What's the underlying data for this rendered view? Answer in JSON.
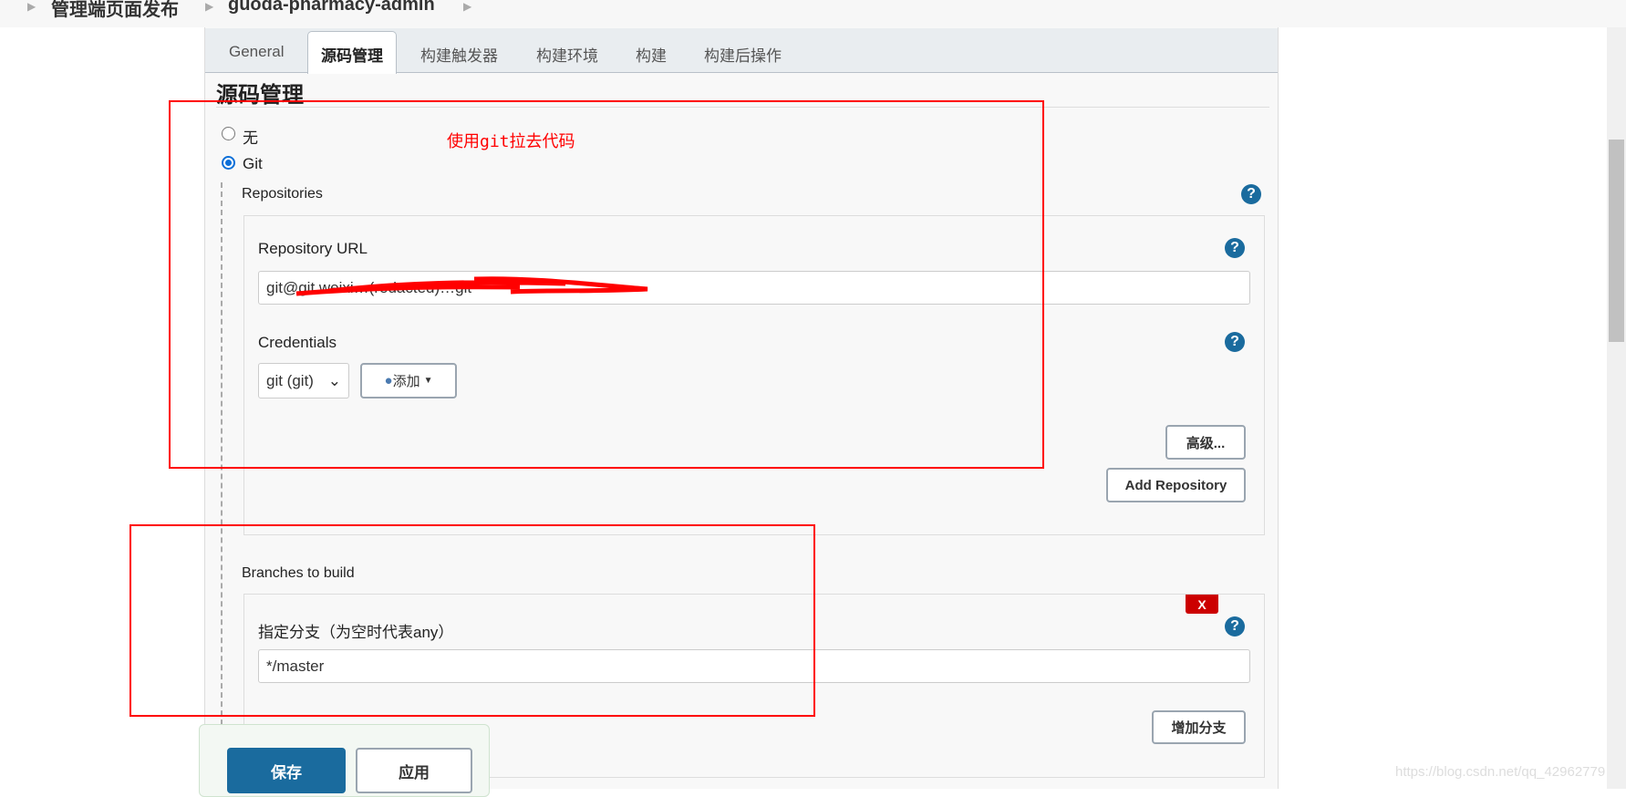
{
  "breadcrumb": [
    "管理端页面发布",
    "guoda-pharmacy-admin"
  ],
  "tabs": [
    "General",
    "源码管理",
    "构建触发器",
    "构建环境",
    "构建",
    "构建后操作"
  ],
  "active_tab": "源码管理",
  "section_title": "源码管理",
  "scm": {
    "options": [
      {
        "label": "无",
        "selected": false
      },
      {
        "label": "Git",
        "selected": true
      }
    ],
    "annotation": "使用git拉去代码",
    "repositories_label": "Repositories",
    "repo_url_label": "Repository URL",
    "repo_url_value": "git@git.weixi…(redacted)…git",
    "credentials_label": "Credentials",
    "credentials_selected": "git (git)",
    "add_button": "添加",
    "advanced_button": "高级...",
    "add_repository_button": "Add Repository",
    "branches_label": "Branches to build",
    "branch_spec_label": "指定分支（为空时代表any）",
    "branch_spec_value": "*/master",
    "delete_badge": "X",
    "add_branch_button": "增加分支"
  },
  "footer": {
    "save": "保存",
    "apply": "应用"
  },
  "watermark": "https://blog.csdn.net/qq_42962779",
  "colors": {
    "accent": "#1a6b9e",
    "annotation": "#ff0000",
    "delete": "#cc0000"
  }
}
